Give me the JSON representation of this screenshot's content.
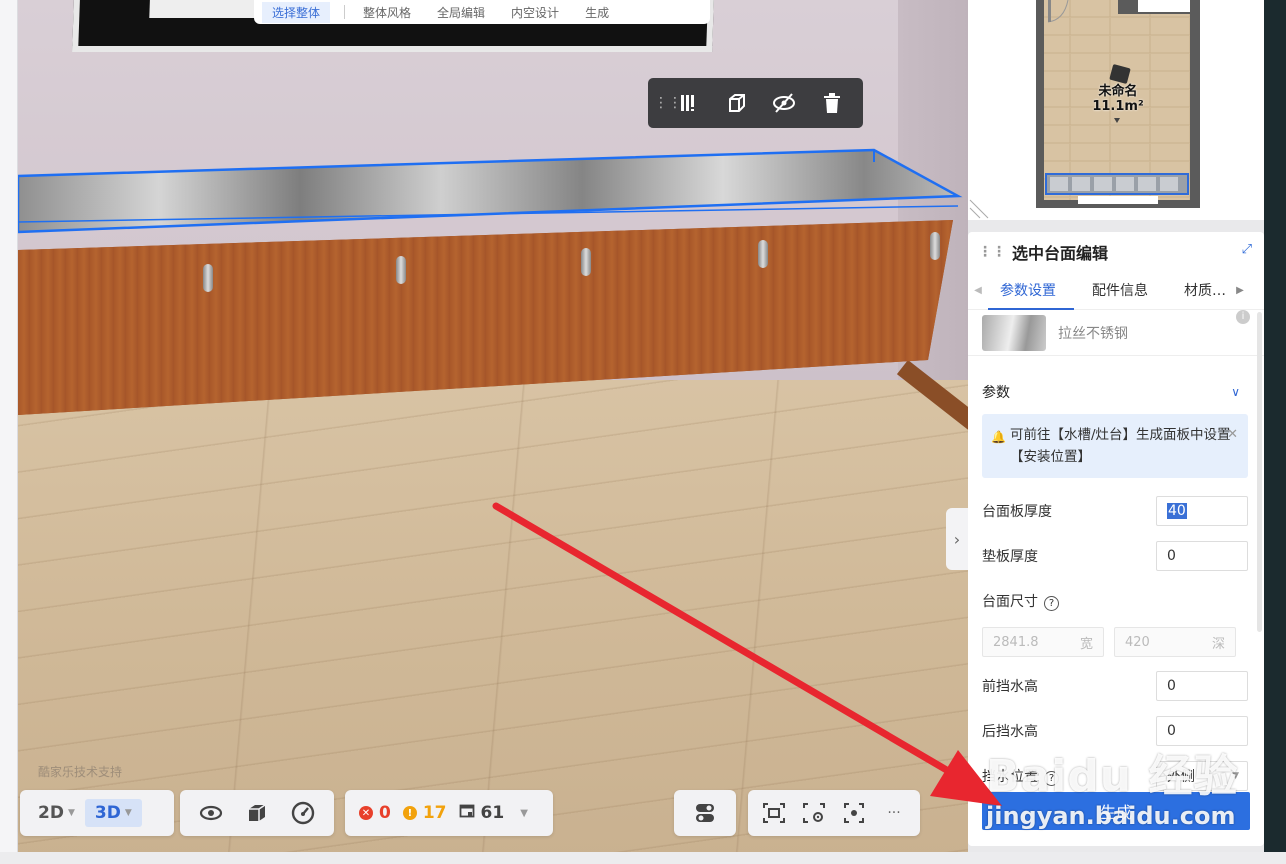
{
  "top_menu": {
    "items": [
      "选择整体",
      "整体风格",
      "全局编辑",
      "内空设计",
      "生成"
    ]
  },
  "viewport": {
    "watermark": "酷家乐技术支持"
  },
  "floorplan": {
    "room_name": "未命名",
    "room_area": "11.1m²"
  },
  "panel": {
    "title": "选中台面编辑",
    "tabs": [
      "参数设置",
      "配件信息",
      "材质…"
    ],
    "material_name": "拉丝不锈钢",
    "section_title": "参数",
    "notice": "可前往【水槽/灶台】生成面板中设置【安装位置】",
    "fields": {
      "thickness_label": "台面板厚度",
      "thickness_value": "40",
      "pad_label": "垫板厚度",
      "pad_value": "0",
      "size_label": "台面尺寸",
      "width_value": "2841.8",
      "width_unit": "宽",
      "depth_value": "420",
      "depth_unit": "深",
      "front_label": "前挡水高",
      "front_value": "0",
      "back_label": "后挡水高",
      "back_value": "0",
      "pos_label": "挡水位置",
      "pos_value": "外侧"
    },
    "generate_label": "生成"
  },
  "bottom_toolbar": {
    "dim_2d": "2D",
    "dim_3d": "3D",
    "errors": "0",
    "warnings": "17",
    "items": "61"
  },
  "watermark": {
    "logo": "Baidu 经验",
    "url": "jingyan.baidu.com"
  },
  "colors": {
    "accent": "#2c6fe0",
    "error": "#e8402b",
    "warning": "#f2a20c"
  }
}
